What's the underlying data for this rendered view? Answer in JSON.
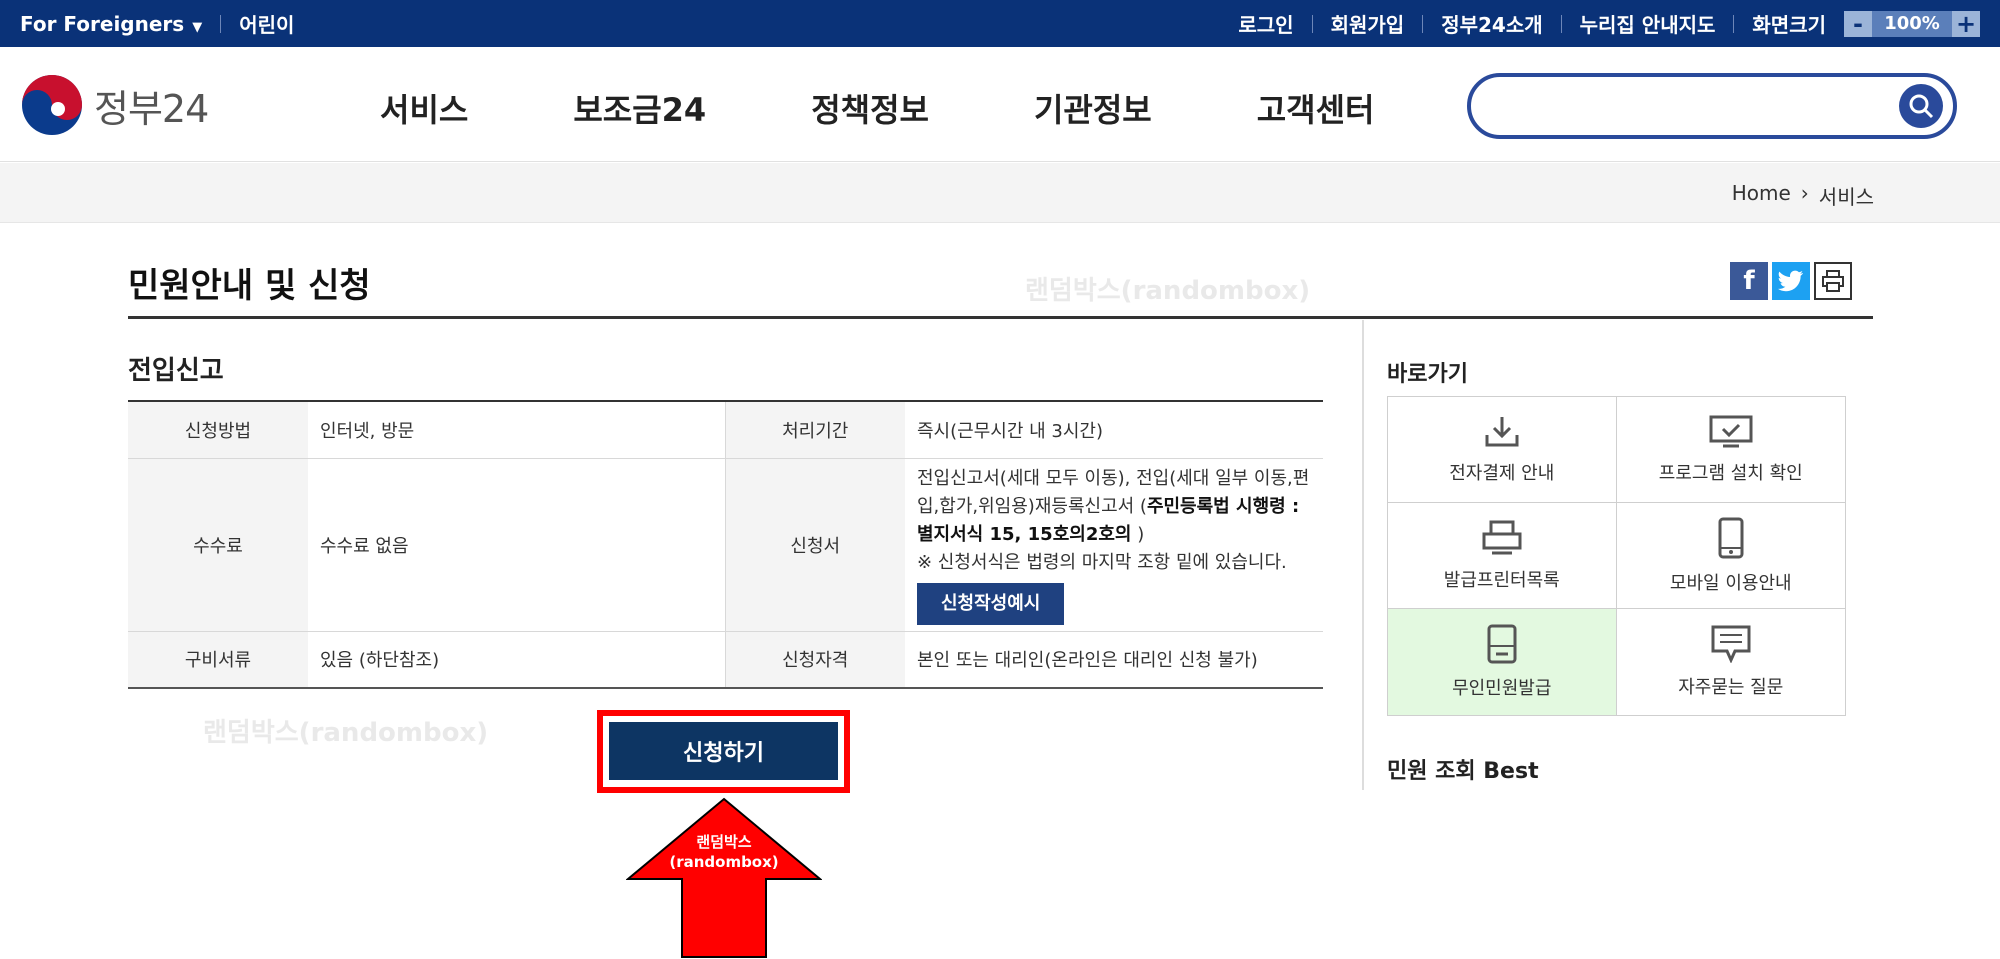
{
  "topbar": {
    "foreigners": "For Foreigners",
    "kids": "어린이",
    "login": "로그인",
    "join": "회원가입",
    "about": "정부24소개",
    "sitemap": "누리집 안내지도",
    "screen_size": "화면크기",
    "zoom_minus": "-",
    "zoom_value": "100%",
    "zoom_plus": "+"
  },
  "header": {
    "logo_text": "정부24",
    "nav": [
      "서비스",
      "보조금24",
      "정책정보",
      "기관정보",
      "고객센터"
    ],
    "search_placeholder": ""
  },
  "breadcrumb": {
    "home": "Home",
    "current": "서비스"
  },
  "page": {
    "title": "민원안내 및 신청",
    "watermark": "랜덤박스(randombox)",
    "subtitle": "전입신고"
  },
  "info": {
    "method_label": "신청방법",
    "method_value": "인터넷, 방문",
    "period_label": "처리기간",
    "period_value": "즉시(근무시간 내 3시간)",
    "fee_label": "수수료",
    "fee_value": "수수료 없음",
    "form_label": "신청서",
    "form_text_1": "전입신고서(세대 모두 이동), 전입(세대 일부 이동,편입,합가,위임용)재등록신고서 (",
    "form_text_bold": "주민등록법 시행령 : 별지서식 15, 15호의2호의",
    "form_text_2": " )",
    "form_note": "※ 신청서식은 법령의 마지막 조항 밑에 있습니다.",
    "form_sample_button": "신청작성예시",
    "docs_label": "구비서류",
    "docs_value": "있음 (하단참조)",
    "qual_label": "신청자격",
    "qual_value": "본인 또는 대리인(온라인은 대리인 신청 불가)"
  },
  "apply_button": "신청하기",
  "arrow_label_1": "랜덤박스",
  "arrow_label_2": "(randombox)",
  "sidebar": {
    "title": "바로가기",
    "items": [
      {
        "label": "전자결제 안내",
        "icon": "download-icon"
      },
      {
        "label": "프로그램 설치 확인",
        "icon": "monitor-check-icon"
      },
      {
        "label": "발급프린터목록",
        "icon": "printer-icon"
      },
      {
        "label": "모바일 이용안내",
        "icon": "mobile-icon"
      },
      {
        "label": "무인민원발급",
        "icon": "kiosk-icon"
      },
      {
        "label": "자주묻는 질문",
        "icon": "chat-icon"
      }
    ],
    "best_title": "민원 조회 Best"
  },
  "colors": {
    "topbar": "#0a3278",
    "brand": "#2a4a9b",
    "apply": "#0d3563",
    "highlight": "#ff0000"
  }
}
